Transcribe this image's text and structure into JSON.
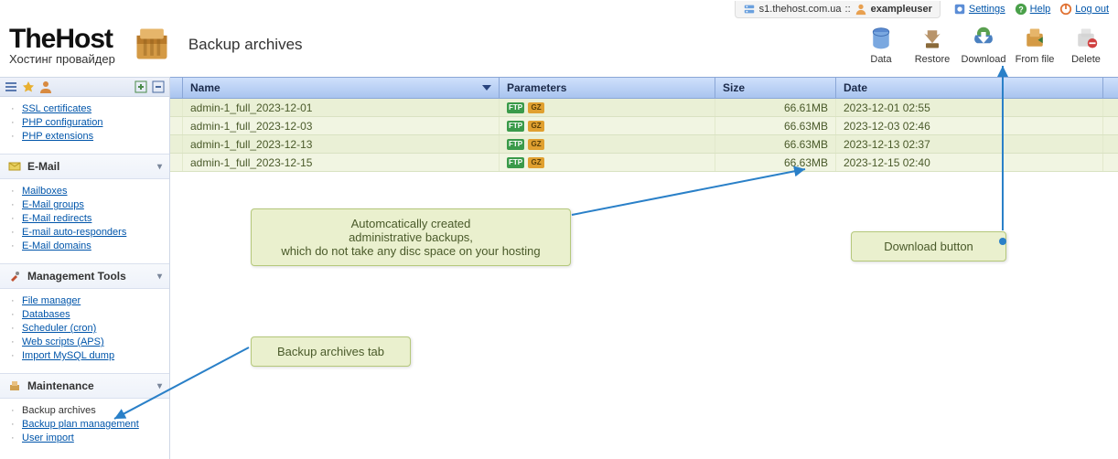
{
  "meta": {
    "server": "s1.thehost.com.ua",
    "sep": " :: ",
    "user": "exampleuser",
    "links": {
      "settings": "Settings",
      "help": "Help",
      "logout": "Log out"
    }
  },
  "brand": {
    "name": "TheHost",
    "tagline": "Хостинг провайдер"
  },
  "page": {
    "title": "Backup archives"
  },
  "toolbar": [
    {
      "id": "data",
      "label": "Data"
    },
    {
      "id": "restore",
      "label": "Restore"
    },
    {
      "id": "download",
      "label": "Download"
    },
    {
      "id": "fromfile",
      "label": "From file"
    },
    {
      "id": "delete",
      "label": "Delete"
    }
  ],
  "sidebar": {
    "top_items": [
      "SSL certificates",
      "PHP configuration",
      "PHP extensions"
    ],
    "groups": [
      {
        "title": "E-Mail",
        "icon": "mail",
        "items": [
          {
            "label": "Mailboxes"
          },
          {
            "label": "E-Mail groups"
          },
          {
            "label": "E-Mail redirects"
          },
          {
            "label": "E-mail auto-responders"
          },
          {
            "label": "E-Mail domains"
          }
        ]
      },
      {
        "title": "Management Tools",
        "icon": "tools",
        "items": [
          {
            "label": "File manager"
          },
          {
            "label": "Databases"
          },
          {
            "label": "Scheduler (cron)"
          },
          {
            "label": "Web scripts (APS)"
          },
          {
            "label": "Import MySQL dump"
          }
        ]
      },
      {
        "title": "Maintenance",
        "icon": "maint",
        "items": [
          {
            "label": "Backup archives",
            "active": true
          },
          {
            "label": "Backup plan management"
          },
          {
            "label": "User import"
          }
        ]
      }
    ]
  },
  "table": {
    "columns": {
      "name": "Name",
      "params": "Parameters",
      "size": "Size",
      "date": "Date"
    },
    "rows": [
      {
        "name": "admin-1_full_2023-12-01",
        "size": "66.61MB",
        "date": "2023-12-01 02:55"
      },
      {
        "name": "admin-1_full_2023-12-03",
        "size": "66.63MB",
        "date": "2023-12-03 02:46"
      },
      {
        "name": "admin-1_full_2023-12-13",
        "size": "66.63MB",
        "date": "2023-12-13 02:37"
      },
      {
        "name": "admin-1_full_2023-12-15",
        "size": "66.63MB",
        "date": "2023-12-15 02:40"
      }
    ]
  },
  "callouts": {
    "auto": "Automcatically created\nadministrative backups,\nwhich do not take any disc space on your hosting",
    "download": "Download button",
    "tab": "Backup archives tab"
  }
}
